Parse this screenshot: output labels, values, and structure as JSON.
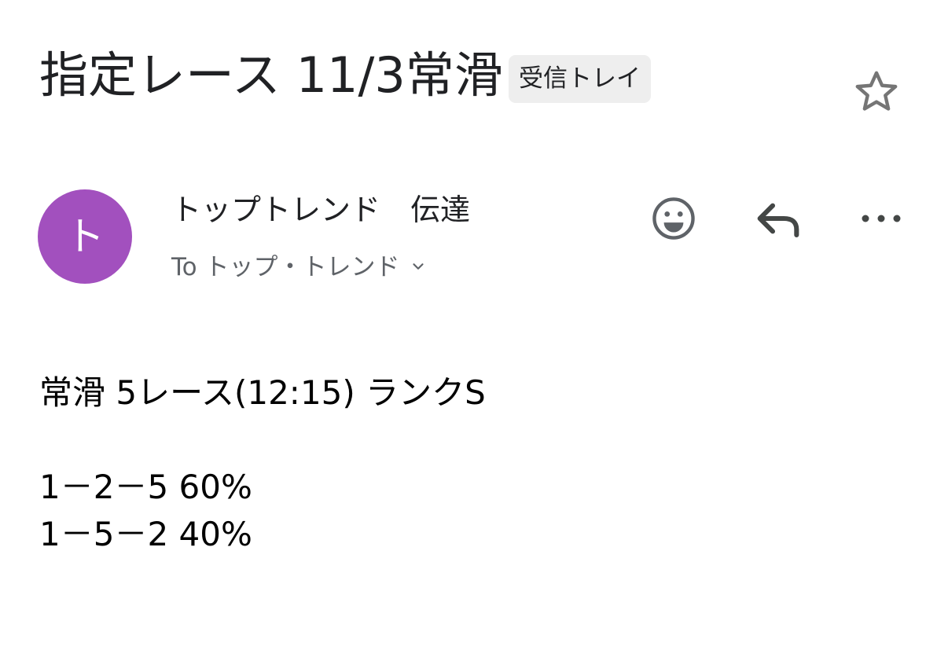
{
  "email": {
    "subject": "指定レース 11/3常滑",
    "label": "受信トレイ",
    "sender": {
      "name": "トップトレンド　伝達",
      "avatar_initial": "ト",
      "avatar_color": "#a250be"
    },
    "recipients": {
      "text": "To トップ・トレンド"
    },
    "body": {
      "lines": [
        "常滑 5レース(12:15) ランクS",
        "1－2－5  60%",
        "1－5－2  40%"
      ]
    }
  },
  "icons": {
    "star": "star-outline-icon",
    "emoji": "smiley-icon",
    "reply": "reply-arrow-icon",
    "more": "more-horizontal-icon",
    "expand": "chevron-down-icon"
  },
  "colors": {
    "icon_gray": "#5f6368",
    "label_bg": "#eeeeee"
  }
}
